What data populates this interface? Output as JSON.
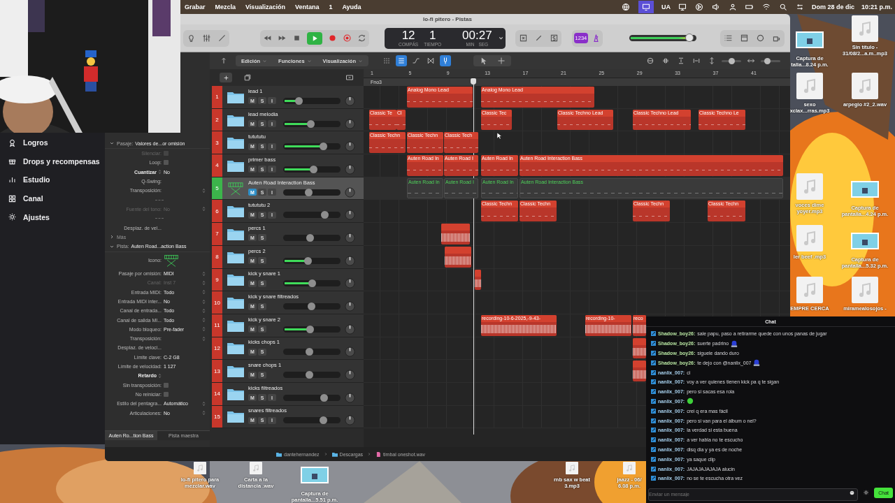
{
  "menu_bar": {
    "menus": [
      "Grabar",
      "Mezcla",
      "Visualización",
      "Ventana",
      "1",
      "Ayuda"
    ],
    "input_source": "UA",
    "date": "Dom 28 de dic",
    "time": "10:21 p.m."
  },
  "sidebar": {
    "items": [
      {
        "label": "Logros"
      },
      {
        "label": "Drops y recompensas"
      },
      {
        "label": "Estudio"
      },
      {
        "label": "Canal"
      },
      {
        "label": "Ajustes"
      }
    ]
  },
  "window": {
    "title": "lo-fi pitero - Pistas"
  },
  "control_bar": {
    "playing": true,
    "bar": "12",
    "beat": "1",
    "bar_label": "COMPÁS",
    "beat_label": "TIEMPO",
    "time": "00:27",
    "min_label": "MIN",
    "sec_label": "SEG",
    "count_in": "1234",
    "master_volume": {
      "level": 0.9
    }
  },
  "toolbar": {
    "menus": [
      "Edición",
      "Funciones",
      "Visualización"
    ],
    "toggles": [
      {
        "selected": false
      },
      {
        "selected": true
      },
      {
        "selected": false
      },
      {
        "selected": false
      },
      {
        "selected": true
      }
    ],
    "zoom_sliders": [
      {
        "level": 0.55
      },
      {
        "level": 0.35
      }
    ]
  },
  "ruler": {
    "bars": [
      "1",
      "5",
      "9",
      "13",
      "17",
      "21",
      "25",
      "29",
      "33",
      "37",
      "41"
    ],
    "marker": "Fno3"
  },
  "tracks": [
    {
      "number": "1",
      "name": "lead 1",
      "kind": "folder",
      "color": "#c8372b",
      "selected": false,
      "muted": false,
      "buttons": {
        "mute": "M",
        "solo": "S",
        "input": "I"
      },
      "active": true,
      "level": 0.27,
      "regions": [
        {
          "kind": "midi",
          "label": "Analog Mono Lead"
        },
        {
          "kind": "midi",
          "label": "Analog Mono Lead"
        }
      ]
    },
    {
      "number": "2",
      "name": "lead melodia",
      "kind": "folder",
      "color": "#c8372b",
      "selected": false,
      "muted": false,
      "buttons": {
        "mute": "M",
        "solo": "S",
        "input": "I"
      },
      "active": true,
      "level": 0.48,
      "regions": [
        {
          "kind": "midi",
          "label": "Classic Te"
        },
        {
          "kind": "midi",
          "label": "Cl"
        },
        {
          "kind": "midi",
          "label": "Classic Tec"
        },
        {
          "kind": "midi",
          "label": "Classic Techno Lead"
        },
        {
          "kind": "midi",
          "label": "Classic Techno Lead"
        },
        {
          "kind": "midi",
          "label": "Classic Techno Le"
        }
      ]
    },
    {
      "number": "3",
      "name": "tutututu",
      "kind": "folder",
      "color": "#c8372b",
      "selected": false,
      "muted": false,
      "buttons": {
        "mute": "M",
        "solo": "S",
        "input": "I"
      },
      "active": true,
      "level": 0.7,
      "regions": [
        {
          "kind": "midi",
          "label": "Classic Techn"
        },
        {
          "kind": "midi",
          "label": "Classic Techn"
        },
        {
          "kind": "midi",
          "label": "Classic Tech"
        }
      ]
    },
    {
      "number": "4",
      "name": "primer bass",
      "kind": "folder",
      "color": "#c8372b",
      "selected": false,
      "muted": false,
      "buttons": {
        "mute": "M",
        "solo": "S",
        "input": "I"
      },
      "active": true,
      "level": 0.52,
      "regions": [
        {
          "kind": "midi",
          "label": "Auten Road In"
        },
        {
          "kind": "midi",
          "label": "Auten Road I"
        },
        {
          "kind": "midi",
          "label": "Auten Road In"
        },
        {
          "kind": "midi",
          "label": "Auten Road Interaction Bass"
        }
      ]
    },
    {
      "number": "5",
      "name": "Auten Road Interaction Bass",
      "kind": "instrument",
      "color": "#3cb44b",
      "selected": true,
      "muted": true,
      "buttons": {
        "mute": "M",
        "solo": "S",
        "input": "I"
      },
      "active": false,
      "level": 0.44,
      "regions": [
        {
          "kind": "midi",
          "label": "Auten Road In"
        },
        {
          "kind": "midi",
          "label": "Auten Road I"
        },
        {
          "kind": "midi",
          "label": "Auten Road In"
        },
        {
          "kind": "midi",
          "label": "Auten Road Interaction Bass"
        }
      ]
    },
    {
      "number": "6",
      "name": "tutututu 2",
      "kind": "folder",
      "color": "#c8372b",
      "selected": false,
      "muted": false,
      "buttons": {
        "mute": "M",
        "solo": "S",
        "input": "I"
      },
      "active": false,
      "level": 0.72,
      "regions": [
        {
          "kind": "midi",
          "label": "Classic Techn"
        },
        {
          "kind": "midi",
          "label": "Classic Techn"
        },
        {
          "kind": "midi",
          "label": "Classic Techn"
        },
        {
          "kind": "midi",
          "label": "Classic Techn"
        }
      ]
    },
    {
      "number": "7",
      "name": "percs 1",
      "kind": "folder",
      "color": "#c8372b",
      "selected": false,
      "muted": false,
      "buttons": {
        "mute": "M",
        "solo": "S"
      },
      "active": false,
      "level": 0.46,
      "regions": [
        {
          "kind": "audio"
        }
      ]
    },
    {
      "number": "8",
      "name": "percs 2",
      "kind": "folder",
      "color": "#c8372b",
      "selected": false,
      "muted": false,
      "buttons": {
        "mute": "M",
        "solo": "S"
      },
      "active": true,
      "level": 0.43,
      "regions": [
        {
          "kind": "audio"
        }
      ]
    },
    {
      "number": "9",
      "name": "kick y snare 1",
      "kind": "folder",
      "color": "#c8372b",
      "selected": false,
      "muted": false,
      "buttons": {
        "mute": "M",
        "solo": "S"
      },
      "active": true,
      "level": 0.5,
      "regions": [
        {
          "kind": "audio"
        }
      ]
    },
    {
      "number": "10",
      "name": "kick y snare filtreados",
      "kind": "folder",
      "color": "#c8372b",
      "selected": false,
      "muted": false,
      "buttons": {
        "mute": "M",
        "solo": "S"
      },
      "active": false,
      "level": 0.49
    },
    {
      "number": "11",
      "name": "kick y snare 2",
      "kind": "folder",
      "color": "#c8372b",
      "selected": false,
      "muted": false,
      "buttons": {
        "mute": "M",
        "solo": "S"
      },
      "active": true,
      "level": 0.46,
      "regions": [
        {
          "kind": "audio",
          "label": "recording-10-6-2025,-9-43-"
        },
        {
          "kind": "audio",
          "label": "recording-10-"
        },
        {
          "kind": "audio",
          "label": "reco"
        }
      ]
    },
    {
      "number": "12",
      "name": "kicks chops 1",
      "kind": "folder",
      "color": "#c8372b",
      "selected": false,
      "muted": false,
      "buttons": {
        "mute": "M",
        "solo": "S"
      },
      "active": false,
      "level": 0.45,
      "regions": [
        {
          "kind": "audio"
        }
      ]
    },
    {
      "number": "13",
      "name": "snare chops 1",
      "kind": "folder",
      "color": "#c8372b",
      "selected": false,
      "muted": false,
      "buttons": {
        "mute": "M",
        "solo": "S"
      },
      "active": false,
      "level": 0.45,
      "regions": [
        {
          "kind": "audio"
        }
      ]
    },
    {
      "number": "14",
      "name": "kicks filtreados",
      "kind": "folder",
      "color": "#c8372b",
      "selected": false,
      "muted": false,
      "buttons": {
        "mute": "M",
        "solo": "S",
        "input": "I"
      },
      "active": false,
      "level": 0.71
    },
    {
      "number": "15",
      "name": "snares filtreados",
      "kind": "folder",
      "color": "#c8372b",
      "selected": false,
      "muted": false,
      "buttons": {
        "mute": "M",
        "solo": "S",
        "input": "I"
      },
      "active": false,
      "level": 0.7
    }
  ],
  "inspector": {
    "sections": [
      {
        "label": "Pasaje:",
        "value": "Valores de...or omisión",
        "expanded": true,
        "rows": [
          {
            "kind": "checkbox",
            "label": "Silenciar:",
            "checked": false,
            "disabled": true
          },
          {
            "kind": "checkbox",
            "label": "Loop:",
            "checked": false,
            "disabled": false
          },
          {
            "kind": "menu",
            "label": "Cuantizar",
            "value": "No",
            "stepper": true,
            "disabled": false
          },
          {
            "kind": "value",
            "label": "Q-Swing:",
            "stepper": false,
            "disabled": false
          },
          {
            "kind": "value",
            "label": "Transposición:",
            "stepper": true,
            "disabled": false
          },
          {
            "kind": "divider"
          },
          {
            "kind": "value",
            "label": "Fuente del tono:",
            "value": "No",
            "stepper": true,
            "disabled": true
          },
          {
            "kind": "divider"
          },
          {
            "kind": "value",
            "label": "Desplaz. de vel...",
            "stepper": false,
            "disabled": false
          },
          {
            "kind": "more",
            "label": "Más",
            "expanded": false
          }
        ]
      },
      {
        "label": "Pista:",
        "value": "Auten Road...action Bass",
        "expanded": true,
        "rows": [
          {
            "kind": "icon",
            "label": "Icono:",
            "disabled": false
          },
          {
            "kind": "value",
            "label": "Pasaje por omisión:",
            "value": "MIDI",
            "stepper": true,
            "disabled": false
          },
          {
            "kind": "value",
            "label": "Canal:",
            "value": "Inst 7",
            "stepper": true,
            "disabled": true
          },
          {
            "kind": "value",
            "label": "Entrada MIDI:",
            "value": "Todo",
            "stepper": true,
            "disabled": false
          },
          {
            "kind": "value",
            "label": "Entrada MIDI inter...",
            "value": "No",
            "stepper": true,
            "disabled": false
          },
          {
            "kind": "value",
            "label": "Canal de entrada...",
            "value": "Todo",
            "stepper": true,
            "disabled": false
          },
          {
            "kind": "value",
            "label": "Canal de salida MI...",
            "value": "Todo",
            "stepper": true,
            "disabled": false
          },
          {
            "kind": "value",
            "label": "Modo bloqueo:",
            "value": "Pre-fader",
            "stepper": true,
            "disabled": false
          },
          {
            "kind": "value",
            "label": "Transposición:",
            "stepper": true,
            "disabled": false
          },
          {
            "kind": "value",
            "label": "Desplaz. de veloci...",
            "stepper": false,
            "disabled": false
          },
          {
            "kind": "value",
            "label": "Límite clave:",
            "value": "C-2  G8",
            "stepper": false,
            "disabled": false
          },
          {
            "kind": "value",
            "label": "Límite de velocidad:",
            "value": "1  127",
            "stepper": false,
            "disabled": false
          },
          {
            "kind": "menu",
            "label": "Retardo",
            "stepper": true,
            "disabled": false
          },
          {
            "kind": "checkbox",
            "label": "Sin transposición:",
            "checked": false,
            "disabled": false
          },
          {
            "kind": "checkbox",
            "label": "No reiniciar:",
            "checked": false,
            "disabled": false
          },
          {
            "kind": "value",
            "label": "Estilo del pentagra...",
            "value": "Automático",
            "stepper": true,
            "disabled": false
          },
          {
            "kind": "value",
            "label": "Articulaciones:",
            "value": "No",
            "stepper": true,
            "disabled": false
          }
        ]
      }
    ],
    "tabs": [
      {
        "label": "Auten Ro...tion Bass",
        "selected": true
      },
      {
        "label": "Pista maestra",
        "selected": false
      }
    ]
  },
  "path_bar": [
    {
      "kind": "folder",
      "label": "dantehernandez"
    },
    {
      "kind": "folder",
      "label": "Descargas"
    },
    {
      "kind": "file",
      "label": "timbal oneshot.wav"
    }
  ],
  "chat": {
    "title": "Chat",
    "messages": [
      {
        "user": "Shadow_boy26:",
        "color": "#b6e3a0",
        "text": "sale papu, paso a retirarme quede con unos panas de jugar"
      },
      {
        "user": "Shadow_boy26:",
        "color": "#b6e3a0",
        "text": "suerte padrino",
        "emote": {
          "kind": "sticker"
        }
      },
      {
        "user": "Shadow_boy26:",
        "color": "#b6e3a0",
        "text": "siguele dando duro"
      },
      {
        "user": "Shadow_boy26:",
        "color": "#b6e3a0",
        "text": "te dejo con @nanlix_007",
        "emote": {
          "kind": "sticker"
        }
      },
      {
        "user": "nanlix_007:",
        "color": "#a9d3f0",
        "text": "ci"
      },
      {
        "user": "nanlix_007:",
        "color": "#a9d3f0",
        "text": "voy a ver quienes tienen kick pa q te sigan"
      },
      {
        "user": "nanlix_007:",
        "color": "#a9d3f0",
        "text": "pero si sacas esa rola"
      },
      {
        "user": "nanlix_007:",
        "color": "#a9d3f0",
        "emote": {
          "kind": "blob"
        }
      },
      {
        "user": "nanlix_007:",
        "color": "#a9d3f0",
        "text": "crei q era mas fácil"
      },
      {
        "user": "nanlix_007:",
        "color": "#a9d3f0",
        "text": "pero si van para el álbum o nel?"
      },
      {
        "user": "nanlix_007:",
        "color": "#a9d3f0",
        "text": "la verdad si esta buena"
      },
      {
        "user": "nanlix_007:",
        "color": "#a9d3f0",
        "text": "a ver habla no te escucho"
      },
      {
        "user": "nanlix_007:",
        "color": "#a9d3f0",
        "text": "disq dia y ya es de noche"
      },
      {
        "user": "nanlix_007:",
        "color": "#a9d3f0",
        "text": "ya saque clip"
      },
      {
        "user": "nanlix_007:",
        "color": "#a9d3f0",
        "text": "JAJAJAJAJAJA alucin"
      },
      {
        "user": "nanlix_007:",
        "color": "#a9d3f0",
        "text": "no se te escucha otra vez"
      }
    ],
    "placeholder": "Enviar un mensaje",
    "send": "Chat"
  },
  "desktop_icons": [
    {
      "kind": "screenshot",
      "label": "Captura de\ntalla...8.24 p.m."
    },
    {
      "kind": "audio",
      "label": "Sin título -\n31/08/2...a.m..mp3"
    },
    {
      "kind": "audio",
      "label": "sexo\nxclax...rras.mp3"
    },
    {
      "kind": "audio",
      "label": "arpegio  #2_2.wav"
    },
    {
      "kind": "audio",
      "label": "voces dime\nyoyer.mp3"
    },
    {
      "kind": "screenshot",
      "label": "Captura de\npantalla...4.24 p.m."
    },
    {
      "kind": "audio",
      "label": "ler beef .mp3"
    },
    {
      "kind": "screenshot",
      "label": "Captura de\npantalla...5.32 p.m."
    },
    {
      "kind": "audio",
      "label": "EMPRE CERCA"
    },
    {
      "kind": "audio",
      "label": "miramealosojos -"
    },
    {
      "kind": "audio",
      "label": "lo-fi pitero para\nmezclar.wav"
    },
    {
      "kind": "audio",
      "label": "Carta a la\ndistancia .wav"
    },
    {
      "kind": "screenshot",
      "label": "Captura de\npantalla...5.51 p.m."
    },
    {
      "kind": "audio",
      "label": "rnb sax w beat\n3.mp3"
    },
    {
      "kind": "audio",
      "label": "jaazz - 06/\n6.08 p.m."
    }
  ]
}
